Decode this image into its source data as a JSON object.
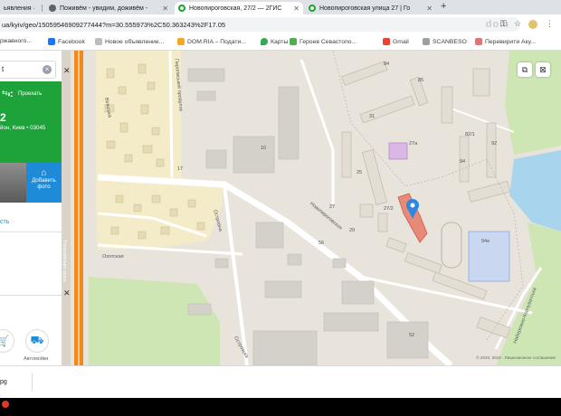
{
  "tabs": [
    {
      "title": "ьявления ·",
      "active": false
    },
    {
      "title": "Поживём - увидим, доживём -",
      "active": false
    },
    {
      "title": "Новопироговская, 27/2 — 2ГИС",
      "active": true
    },
    {
      "title": "Новопироговская улица 27 | Го",
      "active": false
    }
  ],
  "new_tab_symbol": "+",
  "url": "ua/kyiv/geo/15059546909277444?m=30.555973%2C50.363243%2F17.05",
  "url_overlay": "dom",
  "bookmarks": [
    "ржавного...",
    "Facebook",
    "Новое объявление...",
    "DOM.RIA – Подати...",
    "Карты",
    "Героев Севастопо...",
    "Gmail",
    "SCANBESO",
    "Перевирити Аку..."
  ],
  "left_panel": {
    "search_value": "t",
    "search_clear": "×",
    "route_label": "Проехать",
    "building_number": "2",
    "address_line": "йон, Киев • 03045",
    "add_photo_label": "Добавить фото",
    "link_text": "сть",
    "services": [
      "",
      "Автомойки"
    ]
  },
  "map": {
    "labels": {
      "street_main": "Новопироговская",
      "street_ohot": "Охотская",
      "street_ostr": "Островна",
      "street_pr": "Приймальна",
      "street_pirog": "Пирогівський провулок",
      "street_vil": "Вільська",
      "street_gol": "Голосіївське шосе",
      "street_naber": "Набережно-Корчуватська",
      "street_ostr2": "Острозька",
      "b_84": "84",
      "b_85": "85",
      "b_31": "31",
      "b_27": "27",
      "b_27a": "27а",
      "b_25": "25",
      "b_92": "92",
      "b_94": "94",
      "b_94e": "94е",
      "b_10": "10",
      "b_17": "17",
      "b_56": "56",
      "b_52": "52",
      "b_29": "29",
      "b_27b": "27/2",
      "b_821": "82/1"
    },
    "copyright": "© 2GIS, 2019 · Лицензионное соглашение"
  },
  "downloads": {
    "file": "pg"
  },
  "colors": {
    "green_card": "#1ea33a",
    "photo_button": "#1d8bd8",
    "highway": "#f08a1c",
    "residential": "#f4ecc8",
    "park": "#cde6b4",
    "water": "#a9d4ee",
    "marker": "#2e87e0",
    "selected_building": "#e88a7a"
  }
}
